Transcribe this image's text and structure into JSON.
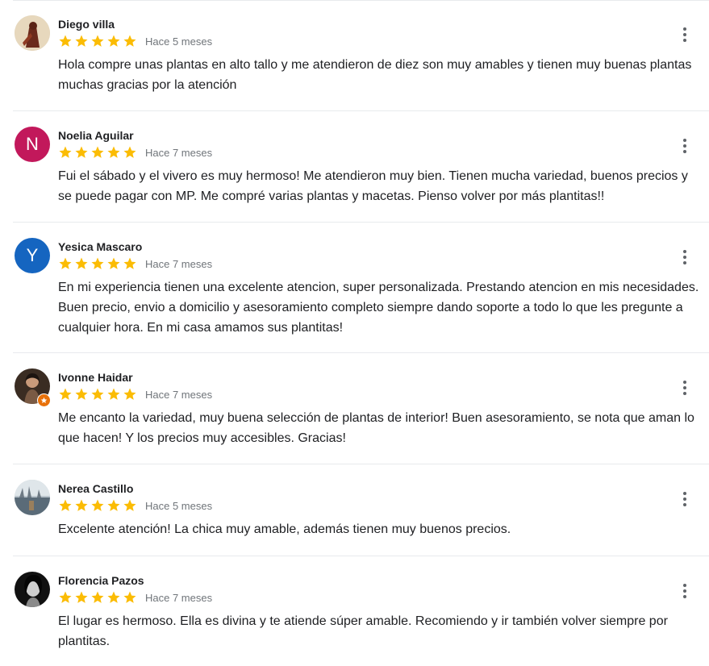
{
  "colors": {
    "star": "#fbbc04",
    "avatar_noelia": "#c2185b",
    "avatar_yesica": "#1565c0",
    "local_guide_badge": "#e8710a"
  },
  "icons": {
    "more": "more-vert-icon",
    "star": "star-icon"
  },
  "reviews": [
    {
      "name": "Diego villa",
      "rating": 5,
      "time": "Hace 5 meses",
      "text": "Hola compre unas plantas en alto tallo y me atendieron de diez son muy amables y tienen muy buenas plantas muchas gracias por la atención"
    },
    {
      "name": "Noelia Aguilar",
      "avatar_letter": "N",
      "rating": 5,
      "time": "Hace 7 meses",
      "text": "Fui el sábado y el vivero es muy hermoso! Me atendieron muy bien. Tienen mucha variedad, buenos precios y se puede pagar con MP. Me compré varias plantas y macetas. Pienso volver por más plantitas!!"
    },
    {
      "name": "Yesica Mascaro",
      "avatar_letter": "Y",
      "rating": 5,
      "time": "Hace 7 meses",
      "text": "En mi experiencia tienen una excelente atencion, super personalizada. Prestando atencion en mis necesidades. Buen precio, envio a domicilio y asesoramiento completo siempre dando soporte a todo lo que les pregunte a cualquier hora. En mi casa amamos sus plantitas!"
    },
    {
      "name": "Ivonne Haidar",
      "rating": 5,
      "time": "Hace 7 meses",
      "text": "Me encanto la variedad, muy buena selección de plantas de interior! Buen asesoramiento, se nota que aman lo que hacen! Y los precios muy accesibles. Gracias!"
    },
    {
      "name": "Nerea Castillo",
      "rating": 5,
      "time": "Hace 5 meses",
      "text": "Excelente atención! La chica muy amable, además tienen muy buenos precios."
    },
    {
      "name": "Florencia Pazos",
      "rating": 5,
      "time": "Hace 7 meses",
      "text": "El lugar es hermoso. Ella es divina y te atiende súper amable. Recomiendo y ir también volver siempre por plantitas."
    }
  ]
}
